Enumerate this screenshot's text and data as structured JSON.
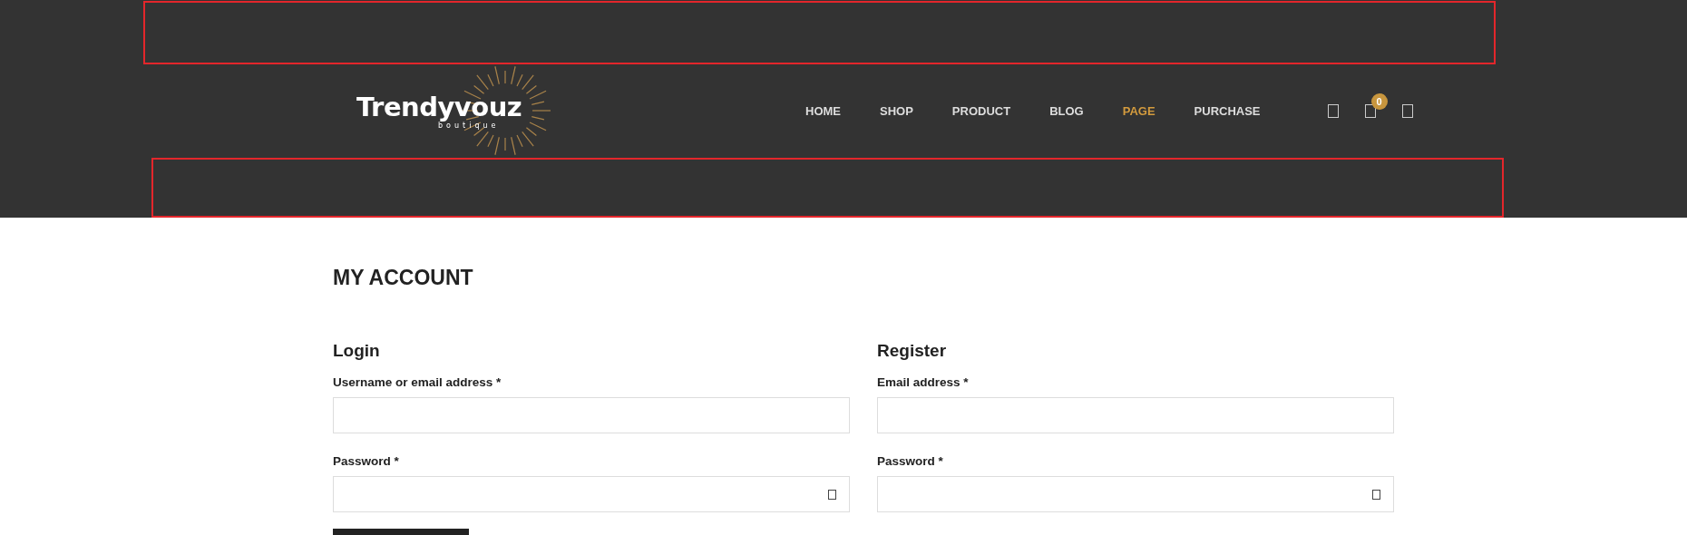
{
  "logo": {
    "name": "Trendyvouz",
    "tagline": "boutique"
  },
  "nav": [
    {
      "label": "HOME",
      "selected": false
    },
    {
      "label": "SHOP",
      "selected": false
    },
    {
      "label": "PRODUCT",
      "selected": false
    },
    {
      "label": "BLOG",
      "selected": false
    },
    {
      "label": "PAGE",
      "selected": true
    },
    {
      "label": "PURCHASE",
      "selected": false
    }
  ],
  "cart_count": "0",
  "page_title": "MY ACCOUNT",
  "forms": [
    {
      "heading": "Login",
      "fields": [
        {
          "label": "Username or email address *",
          "kind": "text"
        },
        {
          "label": "Password *",
          "kind": "password"
        }
      ],
      "kind": "login"
    },
    {
      "heading": "Register",
      "fields": [
        {
          "label": "Email address *",
          "kind": "text"
        },
        {
          "label": "Password *",
          "kind": "password"
        }
      ],
      "kind": "register"
    }
  ]
}
